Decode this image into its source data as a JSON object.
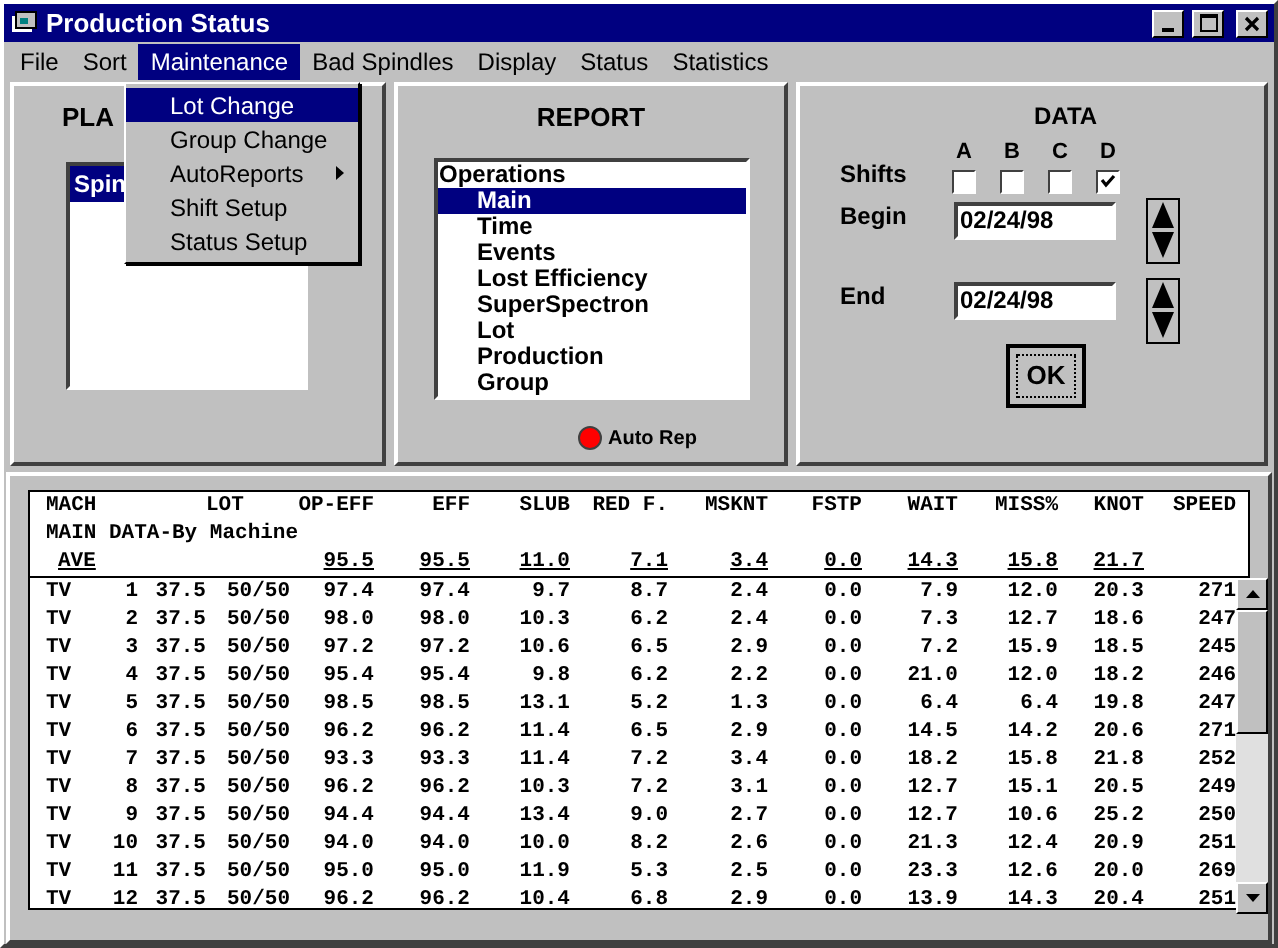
{
  "window": {
    "title": "Production Status"
  },
  "menu": [
    {
      "label": "File",
      "selected": false
    },
    {
      "label": "Sort",
      "selected": false
    },
    {
      "label": "Maintenance",
      "selected": true
    },
    {
      "label": "Bad Spindles",
      "selected": false
    },
    {
      "label": "Display",
      "selected": false
    },
    {
      "label": "Status",
      "selected": false
    },
    {
      "label": "Statistics",
      "selected": false
    }
  ],
  "dropdown": [
    {
      "label": "Lot Change",
      "selected": true,
      "submenu": false
    },
    {
      "label": "Group Change",
      "selected": false,
      "submenu": false
    },
    {
      "label": "AutoReports",
      "selected": false,
      "submenu": true
    },
    {
      "label": "Shift Setup",
      "selected": false,
      "submenu": false
    },
    {
      "label": "Status Setup",
      "selected": false,
      "submenu": false
    }
  ],
  "plant": {
    "heading": "PLA",
    "items": [
      {
        "label": "Spin",
        "selected": true
      }
    ]
  },
  "report": {
    "heading": "REPORT",
    "tree": [
      {
        "label": "Operations",
        "selected": false,
        "children": [
          {
            "label": "Main",
            "selected": true
          },
          {
            "label": "Time",
            "selected": false
          },
          {
            "label": "Events",
            "selected": false
          },
          {
            "label": "Lost Efficiency",
            "selected": false
          },
          {
            "label": "SuperSpectron",
            "selected": false
          },
          {
            "label": "Lot",
            "selected": false
          },
          {
            "label": "Production",
            "selected": false
          },
          {
            "label": "Group",
            "selected": false
          }
        ]
      }
    ],
    "indicator": {
      "label": "Auto Rep",
      "on": true
    }
  },
  "data": {
    "heading": "DATA",
    "shifts_label": "Shifts",
    "shifts": [
      {
        "label": "A",
        "checked": false
      },
      {
        "label": "B",
        "checked": false
      },
      {
        "label": "C",
        "checked": false
      },
      {
        "label": "D",
        "checked": true
      }
    ],
    "begin_label": "Begin",
    "begin": "02/24/98",
    "end_label": "End",
    "end": "02/24/98",
    "ok": "OK"
  },
  "table": {
    "columns": [
      "MACH",
      "",
      "",
      "LOT",
      "OP-EFF",
      "EFF",
      "SLUB",
      "RED F.",
      "MSKNT",
      "FSTP",
      "WAIT",
      "MISS%",
      "KNOT",
      "SPEED"
    ],
    "subtitle": "MAIN DATA-By Machine",
    "average": {
      "label": "AVE",
      "values": [
        "95.5",
        "95.5",
        "11.0",
        "7.1",
        "3.4",
        "0.0",
        "14.3",
        "15.8",
        "21.7"
      ]
    },
    "rows": [
      [
        "TV",
        "1",
        "37.5",
        "50/50",
        "97.4",
        "97.4",
        "9.7",
        "8.7",
        "2.4",
        "0.0",
        "7.9",
        "12.0",
        "20.3",
        "271"
      ],
      [
        "TV",
        "2",
        "37.5",
        "50/50",
        "98.0",
        "98.0",
        "10.3",
        "6.2",
        "2.4",
        "0.0",
        "7.3",
        "12.7",
        "18.6",
        "247"
      ],
      [
        "TV",
        "3",
        "37.5",
        "50/50",
        "97.2",
        "97.2",
        "10.6",
        "6.5",
        "2.9",
        "0.0",
        "7.2",
        "15.9",
        "18.5",
        "245"
      ],
      [
        "TV",
        "4",
        "37.5",
        "50/50",
        "95.4",
        "95.4",
        "9.8",
        "6.2",
        "2.2",
        "0.0",
        "21.0",
        "12.0",
        "18.2",
        "246"
      ],
      [
        "TV",
        "5",
        "37.5",
        "50/50",
        "98.5",
        "98.5",
        "13.1",
        "5.2",
        "1.3",
        "0.0",
        "6.4",
        "6.4",
        "19.8",
        "247"
      ],
      [
        "TV",
        "6",
        "37.5",
        "50/50",
        "96.2",
        "96.2",
        "11.4",
        "6.5",
        "2.9",
        "0.0",
        "14.5",
        "14.2",
        "20.6",
        "271"
      ],
      [
        "TV",
        "7",
        "37.5",
        "50/50",
        "93.3",
        "93.3",
        "11.4",
        "7.2",
        "3.4",
        "0.0",
        "18.2",
        "15.8",
        "21.8",
        "252"
      ],
      [
        "TV",
        "8",
        "37.5",
        "50/50",
        "96.2",
        "96.2",
        "10.3",
        "7.2",
        "3.1",
        "0.0",
        "12.7",
        "15.1",
        "20.5",
        "249"
      ],
      [
        "TV",
        "9",
        "37.5",
        "50/50",
        "94.4",
        "94.4",
        "13.4",
        "9.0",
        "2.7",
        "0.0",
        "12.7",
        "10.6",
        "25.2",
        "250"
      ],
      [
        "TV",
        "10",
        "37.5",
        "50/50",
        "94.0",
        "94.0",
        "10.0",
        "8.2",
        "2.6",
        "0.0",
        "21.3",
        "12.4",
        "20.9",
        "251"
      ],
      [
        "TV",
        "11",
        "37.5",
        "50/50",
        "95.0",
        "95.0",
        "11.9",
        "5.3",
        "2.5",
        "0.0",
        "23.3",
        "12.6",
        "20.0",
        "269"
      ],
      [
        "TV",
        "12",
        "37.5",
        "50/50",
        "96.2",
        "96.2",
        "10.4",
        "6.8",
        "2.9",
        "0.0",
        "13.9",
        "14.3",
        "20.4",
        "251"
      ]
    ]
  }
}
